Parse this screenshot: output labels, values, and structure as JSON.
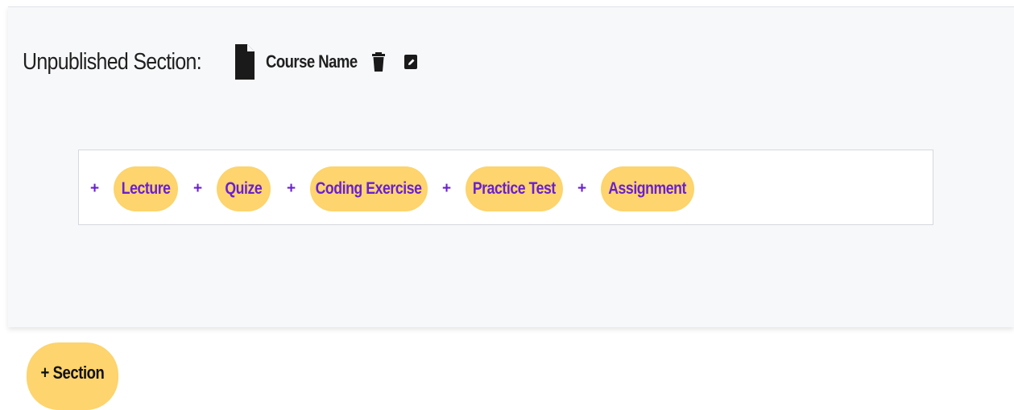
{
  "section": {
    "title": "Unpublished Section:",
    "course_name": "Course Name",
    "icons": {
      "file": "file-icon",
      "delete": "trash-icon",
      "edit": "edit-icon"
    }
  },
  "add_items": [
    {
      "plus": "+",
      "label": "Lecture"
    },
    {
      "plus": "+",
      "label": "Quize"
    },
    {
      "plus": "+",
      "label": "Coding Exercise"
    },
    {
      "plus": "+",
      "label": "Practice Test"
    },
    {
      "plus": "+",
      "label": "Assignment"
    }
  ],
  "add_section_button": {
    "label": "+ Section"
  },
  "colors": {
    "pill_background": "#fdd46d",
    "pill_text": "#6a1fd1",
    "card_background": "#f7f8fa",
    "text_dark": "#1f1f1f"
  }
}
